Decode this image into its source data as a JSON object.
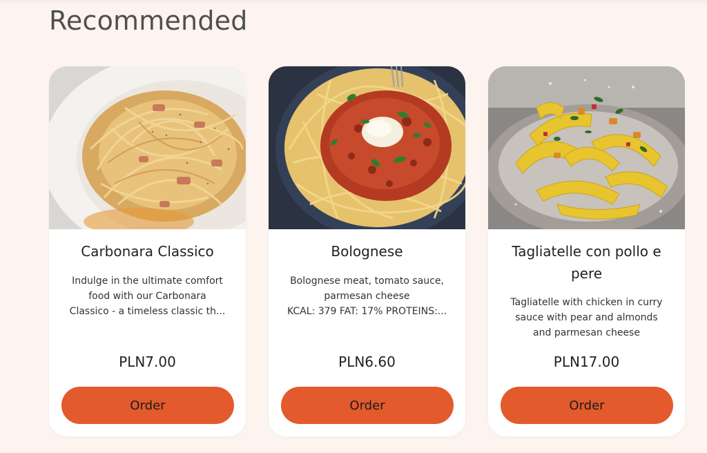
{
  "section": {
    "title": "Recommended"
  },
  "cards": [
    {
      "title": "Carbonara Classico",
      "description": "Indulge in the ultimate comfort\nfood with our Carbonara\nClassico - a timeless classic th...",
      "price": "PLN7.00",
      "order_label": "Order",
      "image": "carbonara-photo"
    },
    {
      "title": "Bolognese",
      "description": "Bolognese meat, tomato sauce,\nparmesan cheese\nKCAL: 379 FAT: 17% PROTEINS:...",
      "price": "PLN6.60",
      "order_label": "Order",
      "image": "bolognese-photo"
    },
    {
      "title": "Tagliatelle con pollo e pere",
      "description": "Tagliatelle with chicken in curry\nsauce with pear and almonds\nand parmesan cheese",
      "price": "PLN17.00",
      "order_label": "Order",
      "image": "tagliatelle-photo"
    }
  ],
  "colors": {
    "page_background": "#fdf4ef",
    "card_background": "#ffffff",
    "order_button": "#e35a2c"
  }
}
